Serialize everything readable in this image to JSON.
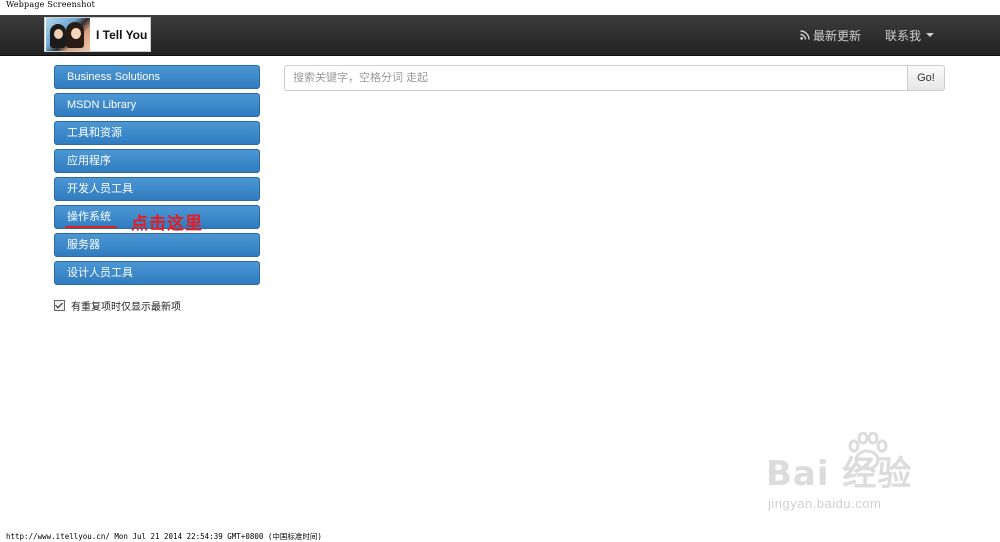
{
  "caption": "Webpage Screenshot",
  "navbar": {
    "brand_text": "I Tell You",
    "links": [
      {
        "label": "最新更新",
        "icon": "rss-icon"
      },
      {
        "label": "联系我",
        "icon": "chevron-down-icon"
      }
    ]
  },
  "sidebar": {
    "items": [
      {
        "label": "Business Solutions"
      },
      {
        "label": "MSDN Library"
      },
      {
        "label": "工具和资源"
      },
      {
        "label": "应用程序"
      },
      {
        "label": "开发人员工具"
      },
      {
        "label": "操作系统"
      },
      {
        "label": "服务器"
      },
      {
        "label": "设计人员工具"
      }
    ],
    "annotation": "点击这里",
    "checkbox_label": "有重复项时仅显示最新项",
    "checkbox_checked": true
  },
  "search": {
    "placeholder": "搜索关键字，空格分词 走起",
    "button_label": "Go!"
  },
  "watermark": {
    "logo": "Bai  经验",
    "sub": "jingyan.baidu.com"
  },
  "footer": {
    "text": "http://www.itellyou.cn/ Mon Jul 21 2014 22:54:39 GMT+0800 (中国标准时间)"
  },
  "colors": {
    "navbar_bg": "#222222",
    "sidebar_button": "#3a86c8",
    "annotation": "#e51c23"
  }
}
